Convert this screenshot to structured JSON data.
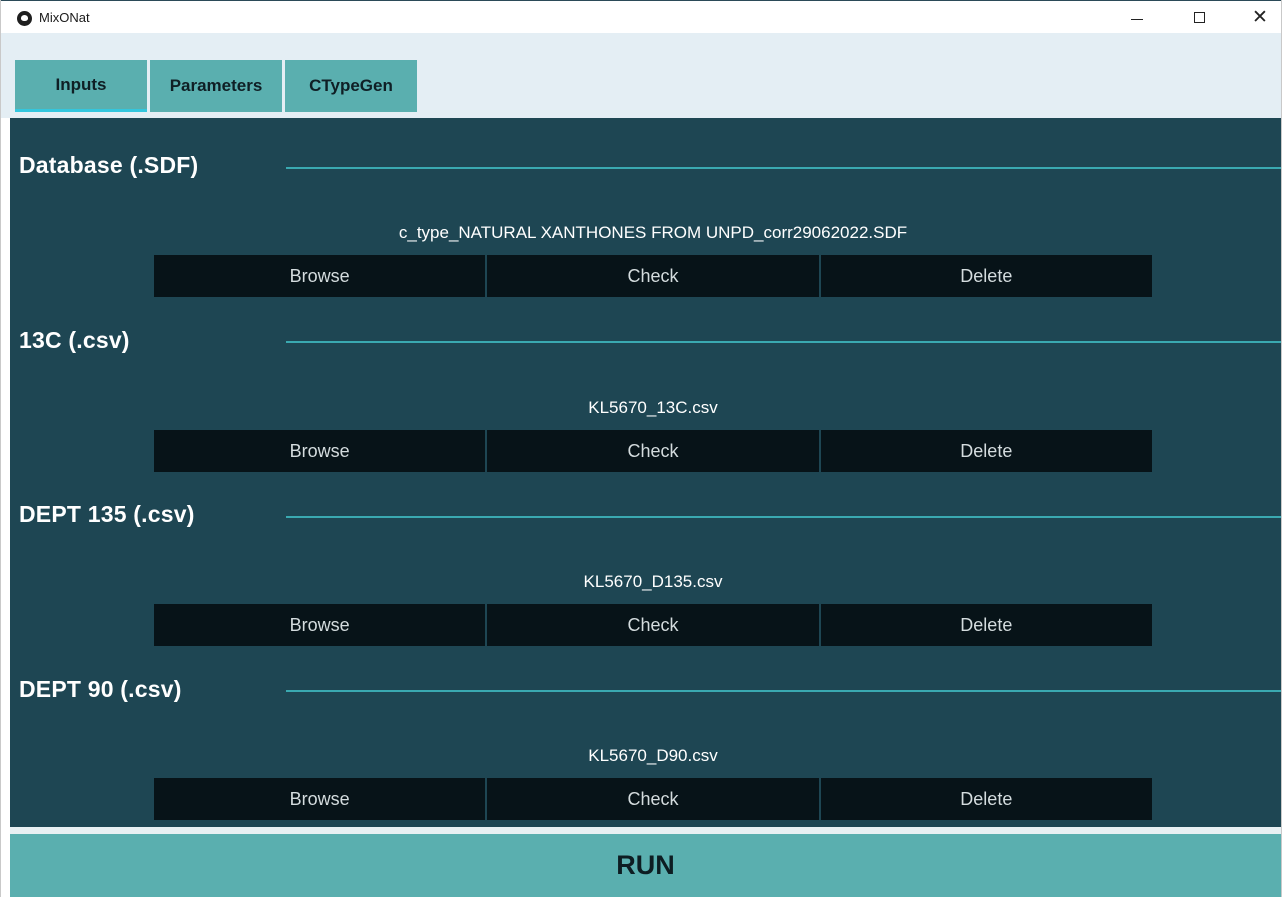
{
  "window": {
    "title": "MixONat",
    "icon": "app-logo-icon",
    "controls": {
      "minimize": "minimize-icon",
      "maximize": "maximize-icon",
      "close": "close-icon"
    }
  },
  "tabs": [
    {
      "label": "Inputs",
      "active": true
    },
    {
      "label": "Parameters",
      "active": false
    },
    {
      "label": "CTypeGen",
      "active": false
    }
  ],
  "sections": [
    {
      "title": "Database (.SDF)",
      "file": "c_type_NATURAL XANTHONES FROM UNPD_corr29062022.SDF",
      "buttons": [
        "Browse",
        "Check",
        "Delete"
      ]
    },
    {
      "title": "13C (.csv)",
      "file": "KL5670_13C.csv",
      "buttons": [
        "Browse",
        "Check",
        "Delete"
      ]
    },
    {
      "title": "DEPT 135 (.csv)",
      "file": "KL5670_D135.csv",
      "buttons": [
        "Browse",
        "Check",
        "Delete"
      ]
    },
    {
      "title": "DEPT 90 (.csv)",
      "file": "KL5670_D90.csv",
      "buttons": [
        "Browse",
        "Check",
        "Delete"
      ]
    }
  ],
  "run_label": "RUN",
  "colors": {
    "panel_bg": "#1e4653",
    "accent": "#5aafaf",
    "line": "#3aa9b1",
    "button_bg": "#071318",
    "tabbar_bg": "#e4eef4"
  }
}
